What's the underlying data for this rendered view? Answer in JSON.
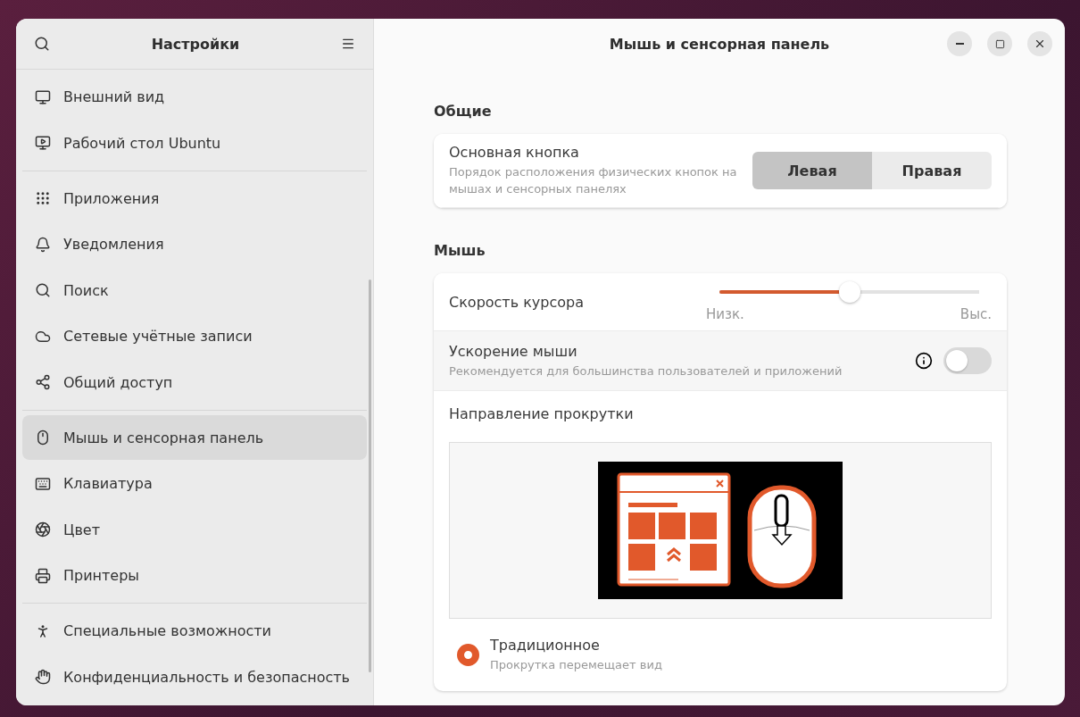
{
  "sidebar": {
    "title": "Настройки",
    "groups": [
      {
        "items": [
          {
            "label": "Внешний вид",
            "selected": false
          },
          {
            "label": "Рабочий стол Ubuntu",
            "selected": false
          }
        ]
      },
      {
        "items": [
          {
            "label": "Приложения",
            "selected": false
          },
          {
            "label": "Уведомления",
            "selected": false
          },
          {
            "label": "Поиск",
            "selected": false
          },
          {
            "label": "Сетевые учётные записи",
            "selected": false
          },
          {
            "label": "Общий доступ",
            "selected": false
          }
        ]
      },
      {
        "items": [
          {
            "label": "Мышь и сенсорная панель",
            "selected": true
          },
          {
            "label": "Клавиатура",
            "selected": false
          },
          {
            "label": "Цвет",
            "selected": false
          },
          {
            "label": "Принтеры",
            "selected": false
          }
        ]
      },
      {
        "items": [
          {
            "label": "Специальные возможности",
            "selected": false
          },
          {
            "label": "Конфиденциальность и безопасность",
            "selected": false
          }
        ]
      }
    ]
  },
  "window": {
    "title": "Мышь и сенсорная панель"
  },
  "general": {
    "heading": "Общие",
    "primary_button": {
      "label": "Основная кнопка",
      "description": "Порядок расположения физических кнопок на мышах и сенсорных панелях",
      "options": [
        {
          "label": "Левая",
          "selected": true
        },
        {
          "label": "Правая",
          "selected": false
        }
      ]
    }
  },
  "mouse": {
    "heading": "Мышь",
    "pointer_speed": {
      "label": "Скорость курсора",
      "level": 0.5,
      "min_label": "Низк.",
      "max_label": "Выс."
    },
    "acceleration": {
      "label": "Ускорение мыши",
      "description": "Рекомендуется для большинства пользователей и приложений",
      "on": false
    },
    "scroll_direction": {
      "label": "Направление прокрутки",
      "options": [
        {
          "label": "Традиционное",
          "description": "Прокрутка перемещает вид",
          "selected": true
        }
      ]
    }
  }
}
